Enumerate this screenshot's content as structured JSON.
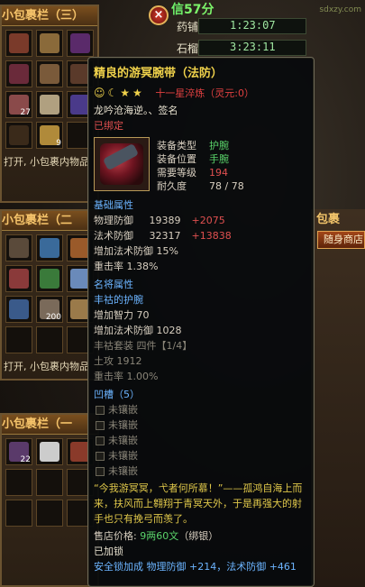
{
  "top": {
    "status_text": "信",
    "timer_minutes": "57分",
    "watermark": "sdxzy.com",
    "timers": [
      {
        "label": "药铺",
        "value": "1:23:07"
      },
      {
        "label": "石榴",
        "value": "3:23:11"
      }
    ]
  },
  "bags": [
    {
      "title": "小包裹栏（三）",
      "hint": "打开, 小包裹内物品"
    },
    {
      "title": "小包裹栏（二",
      "hint": "打开, 小包裹内物品"
    },
    {
      "title": "小包裹栏（一",
      "hint": ""
    }
  ],
  "bag_counts": {
    "a": "27",
    "b": "9",
    "c": "200",
    "d": "22"
  },
  "right_panel": {
    "title": "包裹",
    "button": "随身商店"
  },
  "tooltip": {
    "name": "精良的游冥腕带（法防）",
    "refine_text": "十一星淬炼（灵元:0）",
    "owner": "龙吟沧海逆。、签名",
    "bound": "已绑定",
    "info": [
      {
        "label": "装备类型",
        "value": "护腕"
      },
      {
        "label": "装备位置",
        "value": "手腕"
      },
      {
        "label": "需要等级",
        "value": "194"
      },
      {
        "label": "耐久度",
        "value": "78 / 78"
      }
    ],
    "base_title": "基础属性",
    "base": [
      {
        "label": "物理防御",
        "value": "19389",
        "bonus": "+2075"
      },
      {
        "label": "法术防御",
        "value": "32317",
        "bonus": "+13838"
      },
      {
        "label": "增加法术防御",
        "value": "15%",
        "bonus": ""
      },
      {
        "label": "重击率",
        "value": "1.38%",
        "bonus": ""
      }
    ],
    "named_title": "名将属性",
    "named_subtitle": "丰祜的护腕",
    "named": [
      {
        "label": "增加智力",
        "value": "70"
      },
      {
        "label": "增加法术防御",
        "value": "1028"
      }
    ],
    "set_line": "丰祜套装  四件【1/4】",
    "set_attrs": [
      {
        "label": "土攻",
        "value": "1912"
      },
      {
        "label": "重击率",
        "value": "1.00%"
      }
    ],
    "socket_title": "凹槽（5）",
    "socket_label": "未镶嵌",
    "sockets": [
      "未镶嵌",
      "未镶嵌",
      "未镶嵌",
      "未镶嵌",
      "未镶嵌"
    ],
    "description": "“今我游冥冥，弋者何所慕！”——孤鸿自海上而来，扶风而上翱翔于青冥天外，于是再强大的射手也只有挽弓而羡了。",
    "price_label": "售店价格:",
    "price_value": "9两60文",
    "price_suffix": "（绑银）",
    "locked": "已加锁",
    "lock_bonus": "安全锁加成   物理防御 +214，法术防御 +461"
  }
}
